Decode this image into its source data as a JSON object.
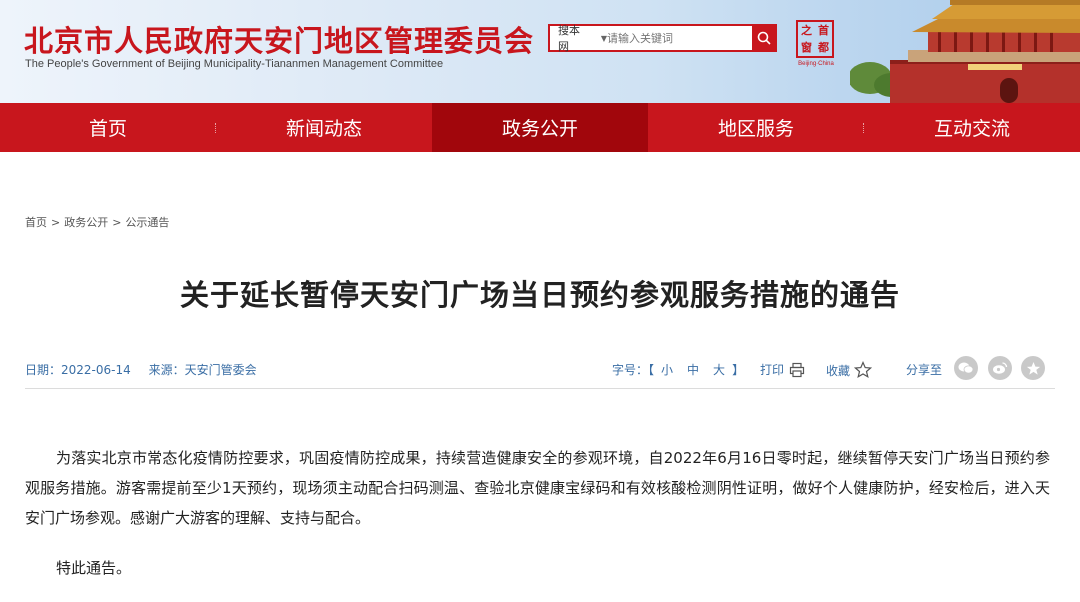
{
  "header": {
    "title_cn": "北京市人民政府天安门地区管理委员会",
    "title_en": "The People's Government of Beijing Municipality-Tiananmen Management Committee",
    "search_scope": "搜本网",
    "search_placeholder": "请输入关键词",
    "seal_chars": [
      "之",
      "首",
      "窗",
      "都"
    ],
    "seal_caption": "Beijing·China"
  },
  "nav": {
    "items": [
      {
        "label": "首页"
      },
      {
        "label": "新闻动态"
      },
      {
        "label": "政务公开",
        "active": true
      },
      {
        "label": "地区服务"
      },
      {
        "label": "互动交流"
      }
    ]
  },
  "breadcrumb": [
    "首页",
    "政务公开",
    "公示通告"
  ],
  "article": {
    "title": "关于延长暂停天安门广场当日预约参观服务措施的通告",
    "date": "日期：2022-06-14",
    "source": "来源：天安门管委会",
    "font_size_label": "字号：【",
    "font_size_options": [
      "小",
      "中",
      "大"
    ],
    "font_size_close": "】",
    "print_label": "打印",
    "favorite_label": "收藏",
    "share_label": "分享至",
    "body": "为落实北京市常态化疫情防控要求，巩固疫情防控成果，持续营造健康安全的参观环境，自2022年6月16日零时起，继续暂停天安门广场当日预约参观服务措施。游客需提前至少1天预约，现场须主动配合扫码测温、查验北京健康宝绿码和有效核酸检测阴性证明，做好个人健康防护，经安检后，进入天安门广场参观。感谢广大游客的理解、支持与配合。",
    "closing": "特此通告。"
  },
  "colors": {
    "brand_red": "#c8161d",
    "nav_active": "#a1060c",
    "meta_blue": "#3a6ea5"
  }
}
